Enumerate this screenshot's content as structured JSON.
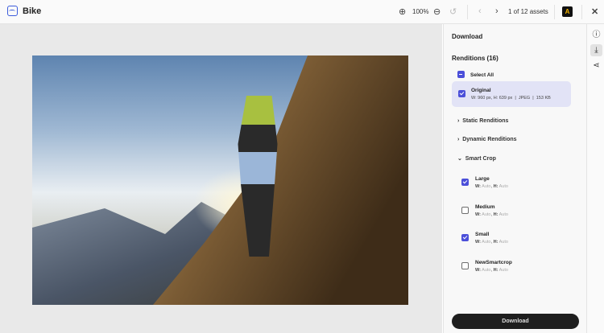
{
  "header": {
    "title": "Bike",
    "zoom": "100%",
    "counter": "1 of 12 assets",
    "app_badge": "A"
  },
  "panel": {
    "title": "Download",
    "renditions": "Renditions (16)",
    "select_all": "Select All",
    "original": {
      "name": "Original",
      "dims": "W: 960 px, H: 639 px",
      "format": "JPEG",
      "size": "153 KB",
      "checked": true
    },
    "sections": {
      "static": "Static Renditions",
      "dynamic": "Dynamic Renditions",
      "smart": "Smart Crop"
    },
    "w_label": "W:",
    "h_label": "H:",
    "auto": "Auto",
    "smart_crops": [
      {
        "name": "Large",
        "checked": true
      },
      {
        "name": "Medium",
        "checked": false
      },
      {
        "name": "Small",
        "checked": true
      },
      {
        "name": "NewSmartcrop",
        "checked": false
      }
    ],
    "download_button": "Download"
  },
  "colors": {
    "accent": "#4b4fd9",
    "selected_bg": "#e2e3f6",
    "button": "#1e1e1e"
  }
}
